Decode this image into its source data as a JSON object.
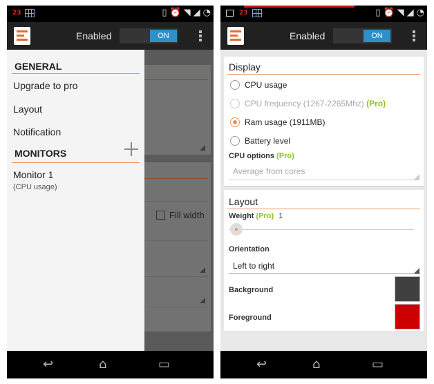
{
  "left_screen": {
    "status_number": "23",
    "action_bar": {
      "title": "Enabled",
      "toggle": "ON"
    },
    "drawer": {
      "general_header": "GENERAL",
      "items": [
        "Upgrade to pro",
        "Layout",
        "Notification"
      ],
      "monitors_header": "MONITORS",
      "monitor_name": "Monitor 1",
      "monitor_type": "(CPU usage)"
    },
    "background": {
      "fill_width_label": "Fill width"
    }
  },
  "right_screen": {
    "status_number": "23",
    "action_bar": {
      "title": "Enabled",
      "toggle": "ON"
    },
    "display": {
      "title": "Display",
      "options": [
        {
          "label": "CPU usage",
          "pro": "",
          "state": "unselected"
        },
        {
          "label": "CPU frequency (1267-2265Mhz)",
          "pro": "(Pro)",
          "state": "disabled"
        },
        {
          "label": "Ram usage (1911MB)",
          "pro": "",
          "state": "selected"
        },
        {
          "label": "Battery level",
          "pro": "",
          "state": "unselected"
        }
      ],
      "cpu_options_label": "CPU options",
      "cpu_options_pro": "(Pro)",
      "cpu_options_value": "Average from cores"
    },
    "layout": {
      "title": "Layout",
      "weight_label": "Weight",
      "weight_pro": "(Pro)",
      "weight_value": "1",
      "orientation_label": "Orientation",
      "orientation_value": "Left to right",
      "background_label": "Background",
      "background_color": "#404040",
      "foreground_label": "Foreground",
      "foreground_color": "#cc0000"
    }
  },
  "colors": {
    "accent": "#e8955d",
    "pro": "#8ec21e",
    "toggle_on": "#2f8fc7"
  },
  "icons": [
    "app-logo-icon",
    "overflow-menu-icon",
    "back-icon",
    "home-icon",
    "recents-icon",
    "add-icon"
  ]
}
